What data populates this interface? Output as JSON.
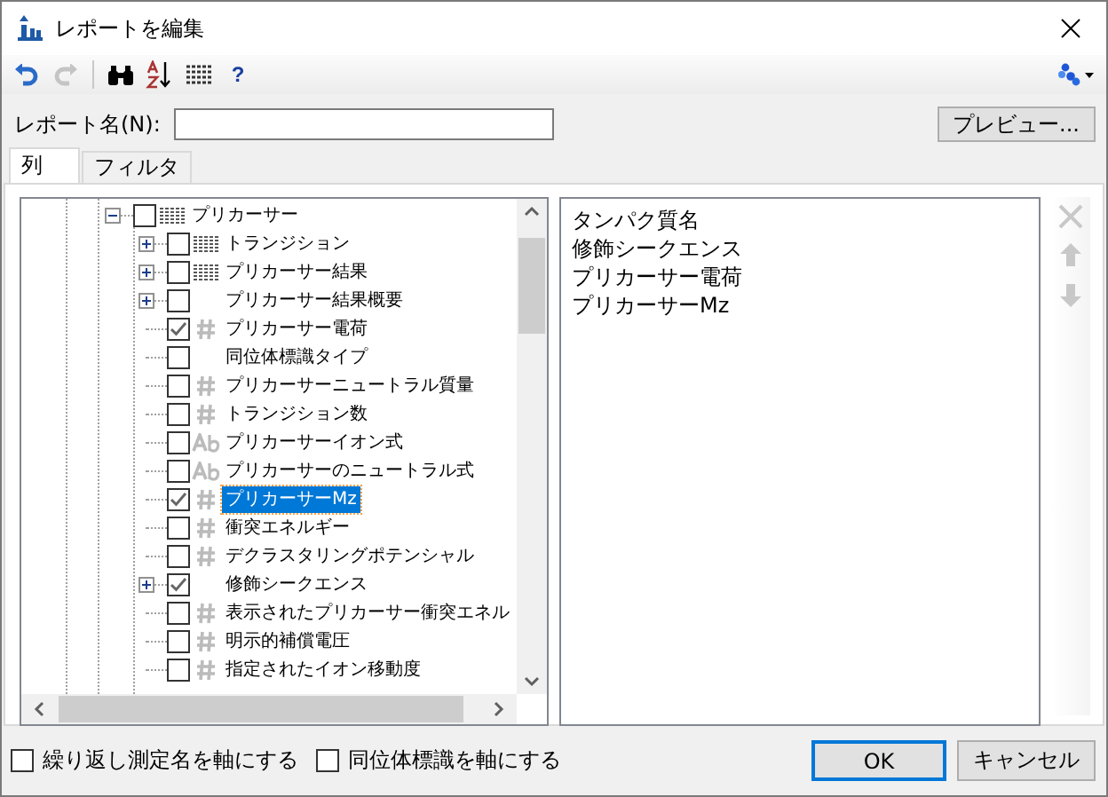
{
  "window": {
    "title": "レポートを編集"
  },
  "toolbar": [
    {
      "kind": "undo",
      "disabled": false
    },
    {
      "kind": "redo",
      "disabled": true
    },
    {
      "kind": "find"
    },
    {
      "kind": "sort"
    },
    {
      "kind": "columns"
    },
    {
      "kind": "help",
      "label": "?"
    }
  ],
  "report_name": {
    "label": "レポート名(N):"
  },
  "preview_button": "プレビュー...",
  "tabs": [
    {
      "label": "列",
      "selected": true
    },
    {
      "label": "フィルタ",
      "selected": false
    }
  ],
  "tree": [
    {
      "label": "プリカーサー",
      "kind": "table",
      "checked": false,
      "selected": false,
      "expanded": true,
      "children": [
        {
          "label": "トランジション",
          "kind": "table",
          "checked": false,
          "selected": false,
          "expanded": false
        },
        {
          "label": "プリカーサー結果",
          "kind": "table",
          "checked": false,
          "selected": false,
          "expanded": false
        },
        {
          "label": "プリカーサー結果概要",
          "kind": "none",
          "checked": false,
          "selected": false,
          "expanded": false
        },
        {
          "label": "プリカーサー電荷",
          "kind": "number",
          "checked": true,
          "selected": false
        },
        {
          "label": "同位体標識タイプ",
          "kind": "none",
          "checked": false,
          "selected": false
        },
        {
          "label": "プリカーサーニュートラル質量",
          "kind": "number",
          "checked": false,
          "selected": false
        },
        {
          "label": "トランジション数",
          "kind": "number",
          "checked": false,
          "selected": false
        },
        {
          "label": "プリカーサーイオン式",
          "kind": "text",
          "checked": false,
          "selected": false
        },
        {
          "label": "プリカーサーのニュートラル式",
          "kind": "text",
          "checked": false,
          "selected": false
        },
        {
          "label": "プリカーサーMz",
          "kind": "number",
          "checked": true,
          "selected": true
        },
        {
          "label": "衝突エネルギー",
          "kind": "number",
          "checked": false,
          "selected": false
        },
        {
          "label": "デクラスタリングポテンシャル",
          "kind": "number",
          "checked": false,
          "selected": false
        },
        {
          "label": "修飾シークエンス",
          "kind": "none",
          "checked": true,
          "selected": false,
          "expanded": false
        },
        {
          "label": "表示されたプリカーサー衝突エネル",
          "kind": "number",
          "checked": false,
          "selected": false
        },
        {
          "label": "明示的補償電圧",
          "kind": "number",
          "checked": false,
          "selected": false
        },
        {
          "label": "指定されたイオン移動度",
          "kind": "number",
          "checked": false,
          "selected": false
        }
      ]
    }
  ],
  "columns_list": [
    "タンパク質名",
    "修飾シークエンス",
    "プリカーサー電荷",
    "プリカーサーMz"
  ],
  "list_actions": [
    {
      "kind": "remove",
      "disabled": true
    },
    {
      "kind": "up",
      "disabled": true
    },
    {
      "kind": "down",
      "disabled": true
    }
  ],
  "options": [
    {
      "label": "繰り返し測定名を軸にする",
      "checked": false
    },
    {
      "label": "同位体標識を軸にする",
      "checked": false
    }
  ],
  "buttons": [
    {
      "label": "OK",
      "default": true
    },
    {
      "label": "キャンセル",
      "default": false
    }
  ]
}
